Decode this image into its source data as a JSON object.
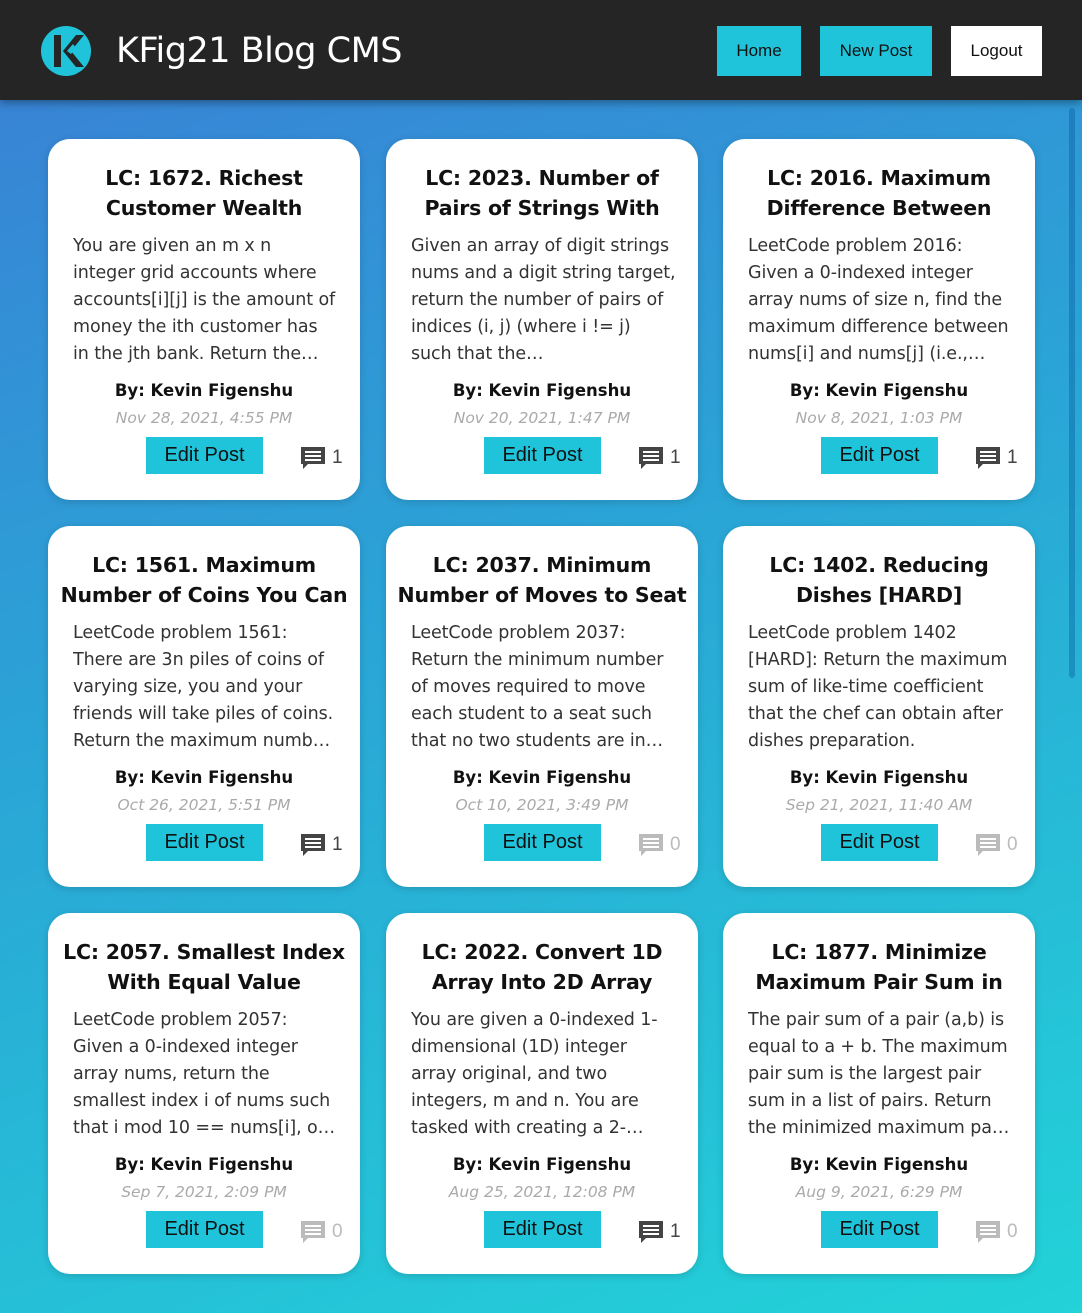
{
  "header": {
    "title": "KFig21 Blog CMS",
    "logo_icon": "kfig-logo-icon",
    "nav": {
      "home_label": "Home",
      "new_post_label": "New Post",
      "logout_label": "Logout"
    }
  },
  "colors": {
    "accent": "#1fc4da",
    "topbar": "#252525",
    "gradient_start": "#3a7fd5",
    "gradient_end": "#22d3d8",
    "comment_active": "#444444",
    "comment_inactive": "#bbbbbb"
  },
  "posts": [
    {
      "title": "LC: 1672. Richest Customer Wealth",
      "excerpt": "You are given an m x n integer grid accounts where accounts[i][j] is the amount of money the ith customer has in the jth bank. Return the…",
      "author": "By: Kevin Figenshu",
      "date": "Nov 28, 2021, 4:55 PM",
      "edit_label": "Edit Post",
      "comments": "1"
    },
    {
      "title": "LC: 2023. Number of Pairs of Strings With",
      "excerpt": "Given an array of digit strings nums and a digit string target, return the number of pairs of indices (i, j) (where i != j) such that the…",
      "author": "By: Kevin Figenshu",
      "date": "Nov 20, 2021, 1:47 PM",
      "edit_label": "Edit Post",
      "comments": "1"
    },
    {
      "title": "LC: 2016. Maximum Difference Between",
      "excerpt": "LeetCode problem 2016: Given a 0-indexed integer array nums of size n, find the maximum difference between nums[i] and nums[j] (i.e.,…",
      "author": "By: Kevin Figenshu",
      "date": "Nov 8, 2021, 1:03 PM",
      "edit_label": "Edit Post",
      "comments": "1"
    },
    {
      "title": "LC: 1561. Maximum Number of Coins You Can",
      "excerpt": "LeetCode problem 1561: There are 3n piles of coins of varying size, you and your friends will take piles of coins. Return the maximum numb…",
      "author": "By: Kevin Figenshu",
      "date": "Oct 26, 2021, 5:51 PM",
      "edit_label": "Edit Post",
      "comments": "1"
    },
    {
      "title": "LC: 2037. Minimum Number of Moves to Seat",
      "excerpt": "LeetCode problem 2037: Return the minimum number of moves required to move each student to a seat such that no two students are in…",
      "author": "By: Kevin Figenshu",
      "date": "Oct 10, 2021, 3:49 PM",
      "edit_label": "Edit Post",
      "comments": "0"
    },
    {
      "title": "LC: 1402. Reducing Dishes [HARD]",
      "excerpt": "LeetCode problem 1402 [HARD]: Return the maximum sum of like-time coefficient that the chef can obtain after dishes preparation.",
      "author": "By: Kevin Figenshu",
      "date": "Sep 21, 2021, 11:40 AM",
      "edit_label": "Edit Post",
      "comments": "0"
    },
    {
      "title": "LC: 2057. Smallest Index With Equal Value",
      "excerpt": "LeetCode problem 2057: Given a 0-indexed integer array nums, return the smallest index i of nums such that i mod 10 == nums[i], o…",
      "author": "By: Kevin Figenshu",
      "date": "Sep 7, 2021, 2:09 PM",
      "edit_label": "Edit Post",
      "comments": "0"
    },
    {
      "title": "LC: 2022. Convert 1D Array Into 2D Array",
      "excerpt": "You are given a 0-indexed 1-dimensional (1D) integer array original, and two integers, m and n. You are tasked with creating a 2-…",
      "author": "By: Kevin Figenshu",
      "date": "Aug 25, 2021, 12:08 PM",
      "edit_label": "Edit Post",
      "comments": "1"
    },
    {
      "title": "LC: 1877. Minimize Maximum Pair Sum in",
      "excerpt": "The pair sum of a pair (a,b) is equal to a + b. The maximum pair sum is the largest pair sum in a list of pairs. Return the minimized maximum pa…",
      "author": "By: Kevin Figenshu",
      "date": "Aug 9, 2021, 6:29 PM",
      "edit_label": "Edit Post",
      "comments": "0"
    }
  ]
}
